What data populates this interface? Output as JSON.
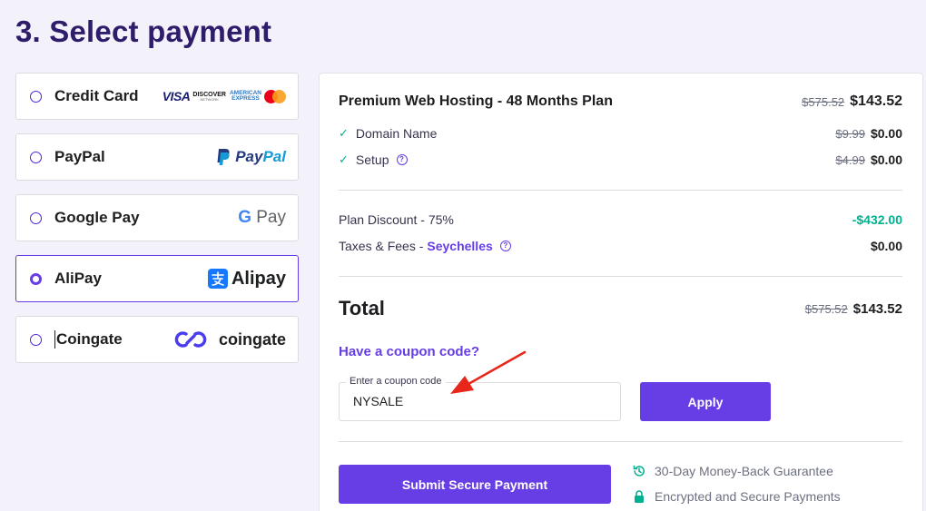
{
  "page": {
    "title": "3. Select payment"
  },
  "methods": [
    {
      "label": "Credit Card",
      "selected": false
    },
    {
      "label": "PayPal",
      "selected": false
    },
    {
      "label": "Google Pay",
      "selected": false
    },
    {
      "label": "AliPay",
      "selected": true
    },
    {
      "label": "Coingate",
      "selected": false
    }
  ],
  "logos": {
    "visa": "VISA",
    "discover_top": "DISCOVER",
    "discover_sub": "NETWORK",
    "amex_top": "AMERICAN",
    "amex_bottom": "EXPRESS",
    "paypal_a": "Pay",
    "paypal_b": "Pal",
    "gpay_g": "G",
    "gpay_pay": "Pay",
    "alipay": "Alipay",
    "coingate": "coingate"
  },
  "summary": {
    "plan": {
      "title": "Premium Web Hosting - 48 Months Plan",
      "old_price": "$575.52",
      "price": "$143.52"
    },
    "items": [
      {
        "label": "Domain Name",
        "old_price": "$9.99",
        "price": "$0.00"
      },
      {
        "label": "Setup",
        "old_price": "$4.99",
        "price": "$0.00"
      }
    ],
    "discount": {
      "label": "Plan Discount - 75%",
      "value": "-$432.00"
    },
    "taxes": {
      "label": "Taxes & Fees -",
      "country": "Seychelles",
      "value": "$0.00"
    },
    "total": {
      "label": "Total",
      "old_price": "$575.52",
      "price": "$143.52"
    }
  },
  "coupon": {
    "link": "Have a coupon code?",
    "field_label": "Enter a coupon code",
    "value": "NYSALE",
    "apply": "Apply"
  },
  "submit": {
    "label": "Submit Secure Payment"
  },
  "assurances": [
    {
      "icon": "history-icon",
      "text": "30-Day Money-Back Guarantee"
    },
    {
      "icon": "lock-icon",
      "text": "Encrypted and Secure Payments"
    }
  ],
  "colors": {
    "accent": "#673de6",
    "title": "#2f1c6a",
    "success": "#00b090",
    "annotation": "#e8271a"
  }
}
